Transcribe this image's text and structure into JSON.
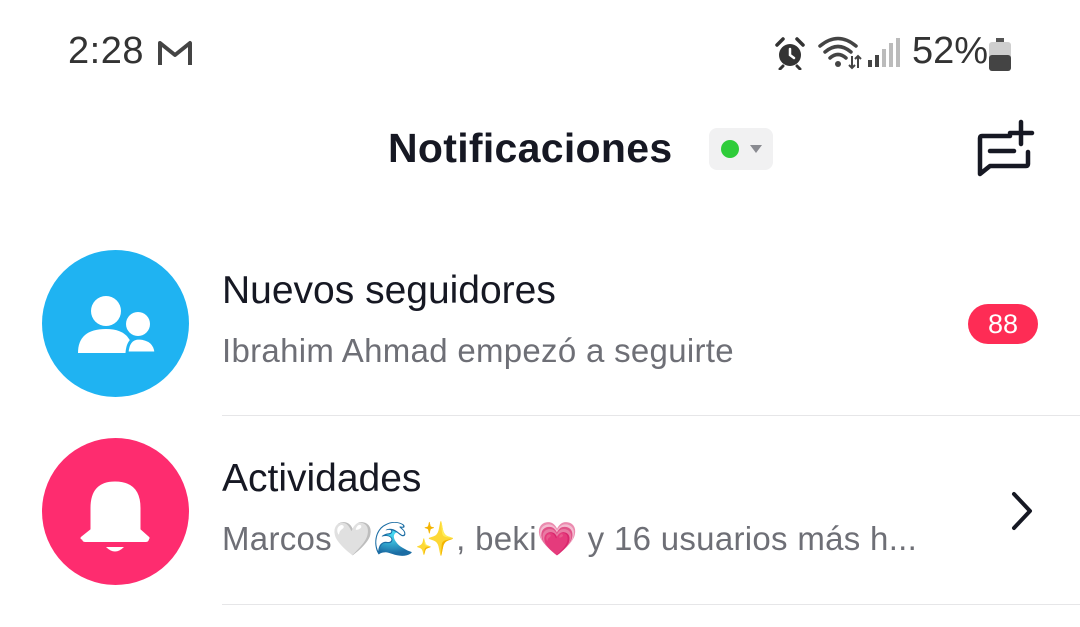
{
  "status_bar": {
    "time": "2:28",
    "battery": "52%",
    "icons": [
      "gmail-icon",
      "alarm-icon",
      "wifi-icon",
      "signal-icon",
      "battery-icon"
    ]
  },
  "header": {
    "title": "Notificaciones",
    "online_status_color": "#2fcc3a",
    "icons": [
      "caret-down-icon",
      "compose-message-icon"
    ]
  },
  "notifications": [
    {
      "title": "Nuevos seguidores",
      "subtitle": "Ibrahim Ahmad empezó a seguirte",
      "badge": "88",
      "icon": "followers-icon",
      "avatar_color": "#1fb3f2"
    },
    {
      "title": "Actividades",
      "subtitle": "Marcos🤍🌊✨, beki💗 y 16 usuarios más h...",
      "icon": "bell-icon",
      "avatar_color": "#fe2c6f",
      "trailing_icon": "chevron-right-icon"
    }
  ],
  "colors": {
    "badge": "#fe2c55",
    "title_text": "#161823",
    "subtitle_text": "#6e6f76"
  }
}
